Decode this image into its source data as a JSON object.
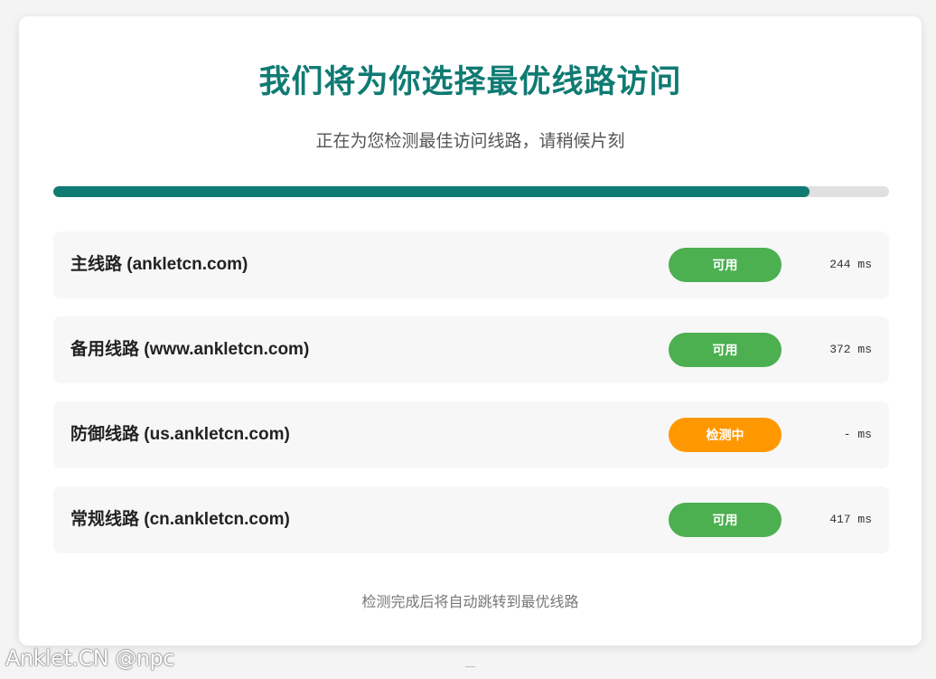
{
  "page": {
    "title": "我们将为你选择最优线路访问",
    "subtitle": "正在为您检测最佳访问线路，请稍候片刻",
    "footer_note": "检测完成后将自动跳转到最优线路",
    "watermark": "Anklet.CN @npc"
  },
  "progress": {
    "percent": 90.5,
    "fill_color": "#0f7b73",
    "track_color": "#e0e0e0"
  },
  "routes": [
    {
      "name": "主线路 (ankletcn.com)",
      "status": "可用",
      "status_color": "#4caf50",
      "latency": "244 ms"
    },
    {
      "name": "备用线路 (www.ankletcn.com)",
      "status": "可用",
      "status_color": "#4caf50",
      "latency": "372 ms"
    },
    {
      "name": "防御线路 (us.ankletcn.com)",
      "status": "检测中",
      "status_color": "#ff9800",
      "latency": "- ms"
    },
    {
      "name": "常规线路 (cn.ankletcn.com)",
      "status": "可用",
      "status_color": "#4caf50",
      "latency": "417 ms"
    }
  ],
  "colors": {
    "accent": "#0f7b73",
    "available": "#4caf50",
    "checking": "#ff9800"
  }
}
